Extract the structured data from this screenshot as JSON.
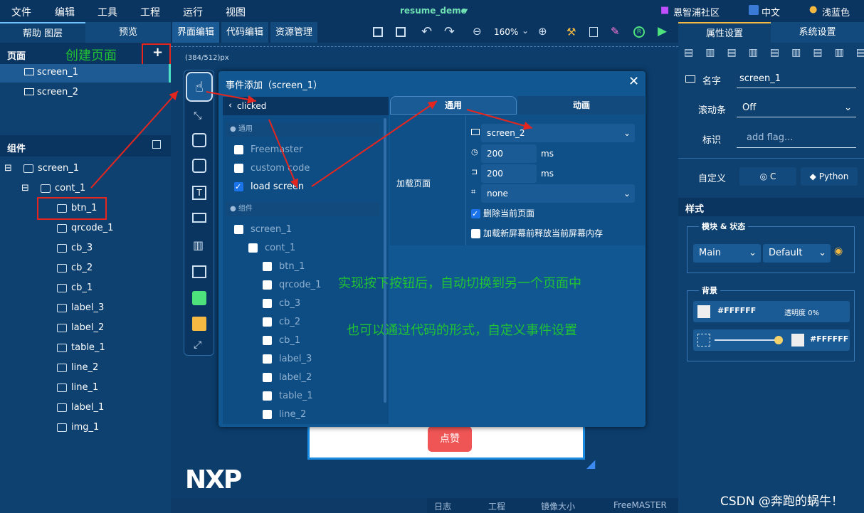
{
  "menubar": {
    "items": [
      "文件",
      "编辑",
      "工具",
      "工程",
      "运行",
      "视图"
    ],
    "project_title": "resume_demo",
    "community": "恩智浦社区",
    "language": "中文",
    "theme": "浅蓝色"
  },
  "left_tabs": {
    "help_layers": "帮助 图层",
    "preview": "预览"
  },
  "editor_tabs": [
    "界面编辑",
    "代码编辑",
    "资源管理"
  ],
  "zoom": "160%",
  "right_tabs": {
    "props": "属性设置",
    "system": "系统设置"
  },
  "pages_panel": {
    "title": "页面",
    "annotation": "创建页面",
    "add_label": "+",
    "screens": [
      "screen_1",
      "screen_2"
    ]
  },
  "components_panel": {
    "title": "组件",
    "tree": [
      {
        "label": "screen_1",
        "depth": 0
      },
      {
        "label": "cont_1",
        "depth": 1
      },
      {
        "label": "btn_1",
        "depth": 2
      },
      {
        "label": "qrcode_1",
        "depth": 2
      },
      {
        "label": "cb_3",
        "depth": 2
      },
      {
        "label": "cb_2",
        "depth": 2
      },
      {
        "label": "cb_1",
        "depth": 2
      },
      {
        "label": "label_3",
        "depth": 2
      },
      {
        "label": "label_2",
        "depth": 2
      },
      {
        "label": "table_1",
        "depth": 2
      },
      {
        "label": "line_2",
        "depth": 2
      },
      {
        "label": "line_1",
        "depth": 2
      },
      {
        "label": "label_1",
        "depth": 2
      },
      {
        "label": "img_1",
        "depth": 2
      }
    ]
  },
  "canvas": {
    "size_label": "(384/512)px",
    "like_button": "点赞",
    "logo": "NXP"
  },
  "dialog": {
    "title": "事件添加（screen_1）",
    "event": "clicked",
    "general_section": "通用",
    "general_items": [
      {
        "label": "Freemaster",
        "checked": false
      },
      {
        "label": "custom code",
        "checked": false
      },
      {
        "label": "load screen",
        "checked": true
      }
    ],
    "component_section": "组件",
    "component_items": [
      {
        "label": "screen_1",
        "depth": 0
      },
      {
        "label": "cont_1",
        "depth": 1
      },
      {
        "label": "btn_1",
        "depth": 2
      },
      {
        "label": "qrcode_1",
        "depth": 2
      },
      {
        "label": "cb_3",
        "depth": 2
      },
      {
        "label": "cb_2",
        "depth": 2
      },
      {
        "label": "cb_1",
        "depth": 2
      },
      {
        "label": "label_3",
        "depth": 2
      },
      {
        "label": "label_2",
        "depth": 2
      },
      {
        "label": "table_1",
        "depth": 2
      },
      {
        "label": "line_2",
        "depth": 2
      }
    ],
    "tab_general": "通用",
    "tab_anim": "动画",
    "load_page_label": "加载页面",
    "target_screen": "screen_2",
    "delay": "200",
    "duration": "200",
    "unit": "ms",
    "anim": "none",
    "delete_current": "删除当前页面",
    "release_before": "加载新屏幕前释放当前屏幕内存",
    "note1": "实现按下按钮后，自动切换到另一个页面中",
    "note2": "也可以通过代码的形式，自定义事件设置"
  },
  "properties": {
    "name_label": "名字",
    "name_value": "screen_1",
    "scroll_label": "滚动条",
    "scroll_value": "Off",
    "flag_label": "标识",
    "flag_placeholder": "add flag...",
    "custom_label": "自定义",
    "c_label": "C",
    "python_label": "Python",
    "style_title": "样式",
    "module_state": "模块 & 状态",
    "part": "Main",
    "state": "Default",
    "bg_title": "背景",
    "bg_color": "#FFFFFF",
    "opacity_label": "透明度 0%",
    "grad_color": "#FFFFFF"
  },
  "statusbar": [
    "日志",
    "工程",
    "镜像大小",
    "FreeMASTER"
  ],
  "watermark": "CSDN @奔跑的蜗牛！"
}
